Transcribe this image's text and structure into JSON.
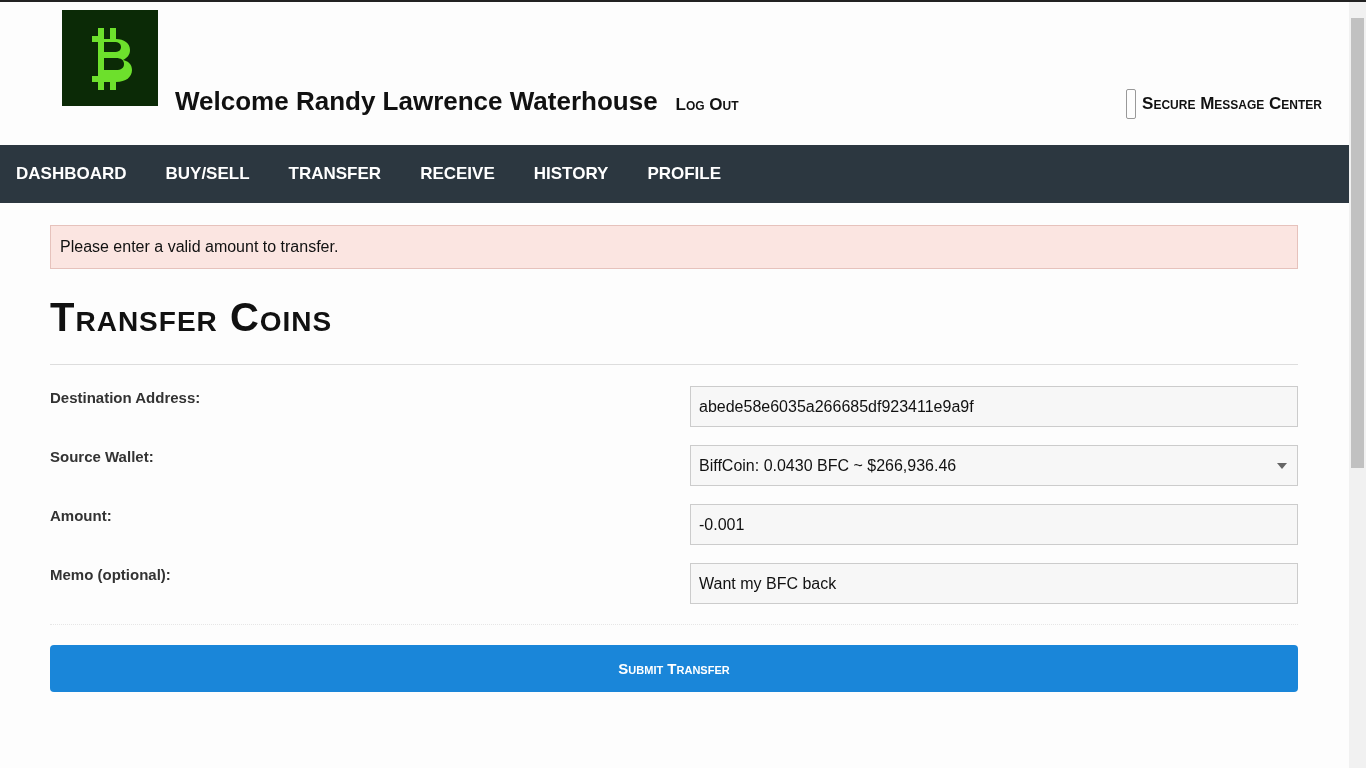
{
  "header": {
    "welcome": "Welcome Randy Lawrence Waterhouse",
    "logout": "Log Out",
    "message_center": "Secure Message Center"
  },
  "nav": [
    {
      "label": "DASHBOARD"
    },
    {
      "label": "BUY/SELL"
    },
    {
      "label": "TRANSFER"
    },
    {
      "label": "RECEIVE"
    },
    {
      "label": "HISTORY"
    },
    {
      "label": "PROFILE"
    }
  ],
  "alert": "Please enter a valid amount to transfer.",
  "title": "Transfer Coins",
  "fields": [
    {
      "label": "Destination Address:",
      "kind": "text",
      "value": "abede58e6035a266685df923411e9a9f"
    },
    {
      "label": "Source Wallet:",
      "kind": "select",
      "value": "BiffCoin: 0.0430 BFC ~ $266,936.46"
    },
    {
      "label": "Amount:",
      "kind": "text",
      "value": "-0.001"
    },
    {
      "label": "Memo (optional):",
      "kind": "text",
      "value": "Want my BFC back"
    }
  ],
  "submit": "Submit Transfer"
}
